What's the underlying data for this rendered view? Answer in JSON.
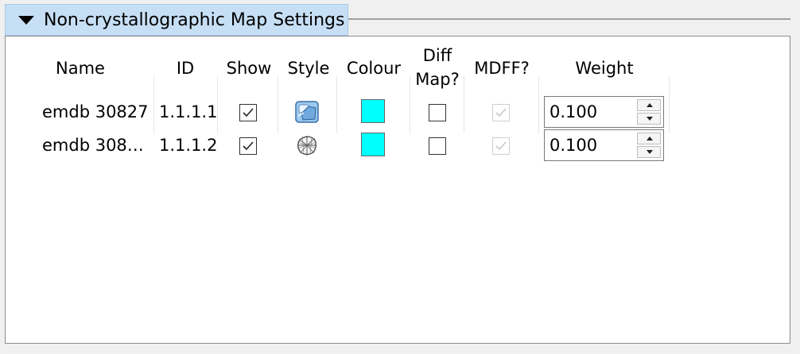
{
  "section": {
    "title": "Non-crystallographic Map Settings",
    "collapse_icon": "triangle-down-icon"
  },
  "columns": {
    "name": "Name",
    "id": "ID",
    "show": "Show",
    "style": "Style",
    "colour": "Colour",
    "diff_line1": "Diff",
    "diff_line2": "Map?",
    "mdff": "MDFF?",
    "weight": "Weight"
  },
  "rows": [
    {
      "name": "emdb 30827",
      "id": "1.1.1.1",
      "show": true,
      "style_icon": "solid-surface-icon",
      "colour": "#00ffff",
      "diff_map": false,
      "mdff": true,
      "mdff_enabled": false,
      "weight": "0.100"
    },
    {
      "name": "emdb 308…",
      "id": "1.1.1.2",
      "show": true,
      "style_icon": "mesh-icon",
      "colour": "#00ffff",
      "diff_map": false,
      "mdff": true,
      "mdff_enabled": false,
      "weight": "0.100"
    }
  ]
}
